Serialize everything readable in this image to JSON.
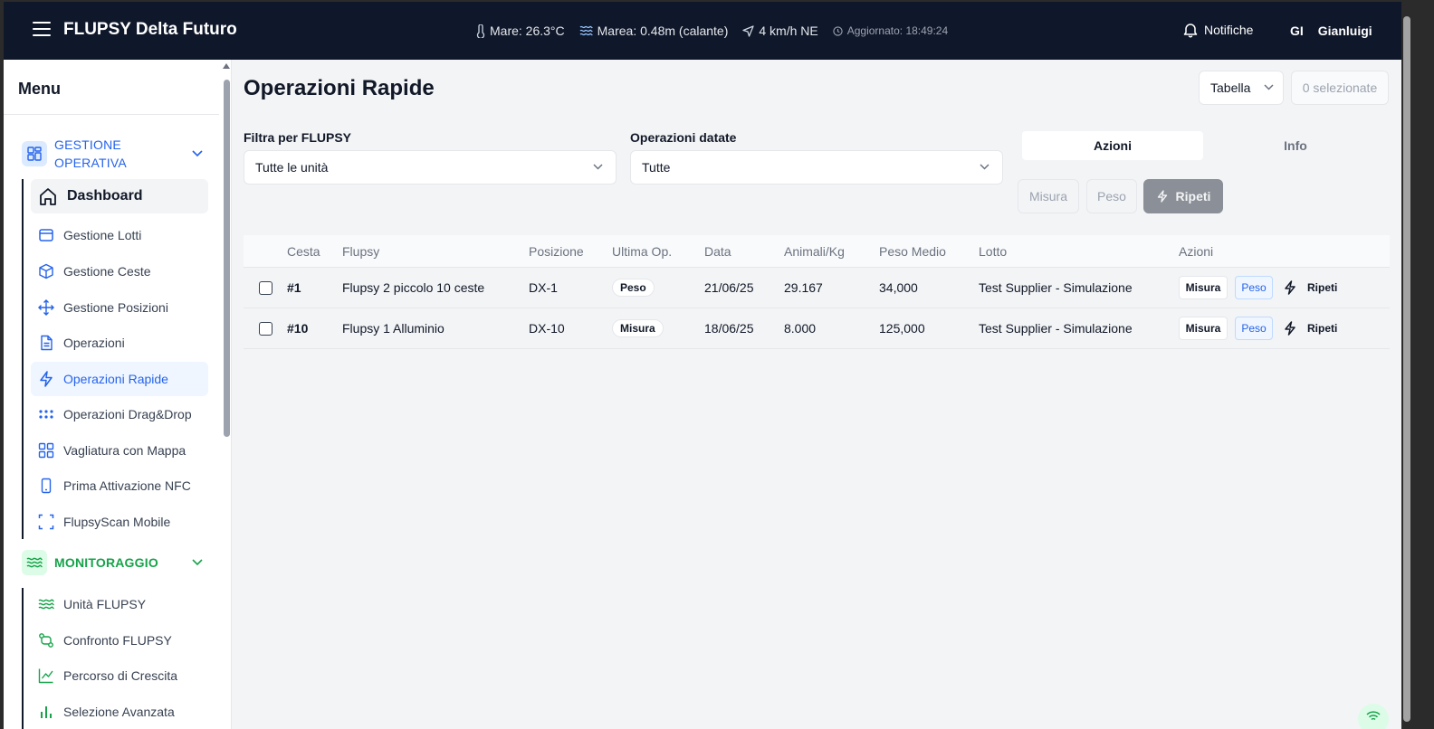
{
  "header": {
    "app_title": "FLUPSY Delta Futuro",
    "sea_temp": "Mare: 26.3°C",
    "tide": "Marea: 0.48m (calante)",
    "wind": "4 km/h NE",
    "updated": "Aggiornato: 18:49:24",
    "notifications_label": "Notifiche",
    "user_initials": "GI",
    "user_name": "Gianluigi"
  },
  "sidebar": {
    "title": "Menu",
    "section_operativa": "GESTIONE OPERATIVA",
    "section_monitoraggio": "MONITORAGGIO",
    "operativa_items": [
      {
        "label": "Dashboard",
        "icon": "home-icon"
      },
      {
        "label": "Gestione Lotti",
        "icon": "box-icon"
      },
      {
        "label": "Gestione Ceste",
        "icon": "cube-icon"
      },
      {
        "label": "Gestione Posizioni",
        "icon": "move-icon"
      },
      {
        "label": "Operazioni",
        "icon": "file-icon"
      },
      {
        "label": "Operazioni Rapide",
        "icon": "zap-icon"
      },
      {
        "label": "Operazioni Drag&Drop",
        "icon": "grip-icon"
      },
      {
        "label": "Vagliatura con Mappa",
        "icon": "grid-icon"
      },
      {
        "label": "Prima Attivazione NFC",
        "icon": "phone-icon"
      },
      {
        "label": "FlupsyScan Mobile",
        "icon": "scan-icon"
      }
    ],
    "monitoraggio_items": [
      {
        "label": "Unità FLUPSY",
        "icon": "waves-icon"
      },
      {
        "label": "Confronto FLUPSY",
        "icon": "compare-icon"
      },
      {
        "label": "Percorso di Crescita",
        "icon": "trend-icon"
      },
      {
        "label": "Selezione Avanzata",
        "icon": "bar-chart-icon"
      }
    ]
  },
  "main": {
    "title": "Operazioni Rapide",
    "view_mode": "Tabella",
    "selected_count": "0 selezionate",
    "filter_flupsy_label": "Filtra per FLUPSY",
    "filter_flupsy_value": "Tutte le unità",
    "filter_dated_label": "Operazioni datate",
    "filter_dated_value": "Tutte",
    "tab_actions": "Azioni",
    "tab_info": "Info",
    "btn_misura": "Misura",
    "btn_peso": "Peso",
    "btn_ripeti": "Ripeti"
  },
  "table": {
    "columns": [
      "Cesta",
      "Flupsy",
      "Posizione",
      "Ultima Op.",
      "Data",
      "Animali/Kg",
      "Peso Medio",
      "Lotto",
      "Azioni"
    ],
    "rows": [
      {
        "cesta": "#1",
        "flupsy": "Flupsy 2 piccolo 10 ceste",
        "posizione": "DX-1",
        "ultima_op": "Peso",
        "data": "21/06/25",
        "animali_kg": "29.167",
        "peso_medio": "34,000",
        "lotto": "Test Supplier - Simulazione",
        "a_misura": "Misura",
        "a_peso": "Peso",
        "a_ripeti": "Ripeti"
      },
      {
        "cesta": "#10",
        "flupsy": "Flupsy 1 Alluminio",
        "posizione": "DX-10",
        "ultima_op": "Misura",
        "data": "18/06/25",
        "animali_kg": "8.000",
        "peso_medio": "125,000",
        "lotto": "Test Supplier - Simulazione",
        "a_misura": "Misura",
        "a_peso": "Peso",
        "a_ripeti": "Ripeti"
      }
    ]
  },
  "colors": {
    "header_bg": "#0f172a",
    "accent_blue": "#2563eb",
    "accent_green": "#16a34a"
  }
}
